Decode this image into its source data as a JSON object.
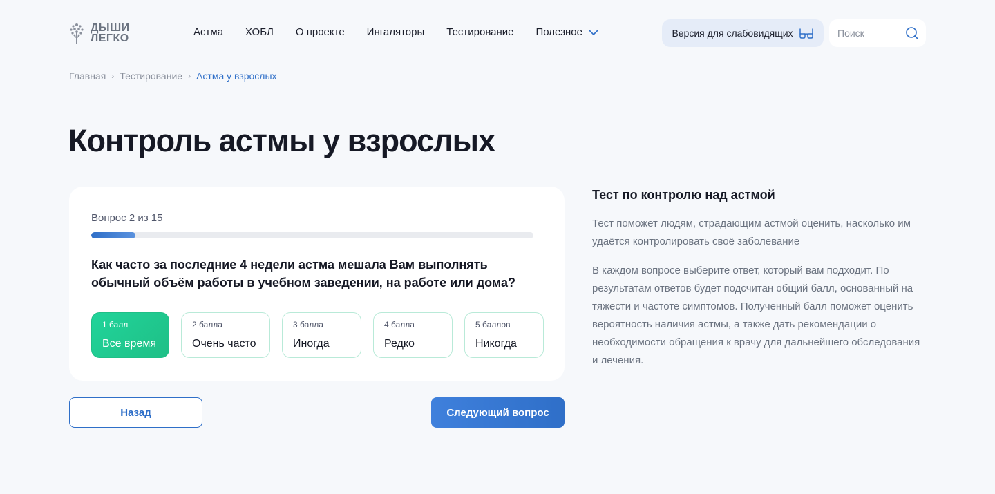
{
  "logo": {
    "line1": "ДЫШИ",
    "line2": "ЛЕГКО"
  },
  "nav": [
    {
      "label": "Астма"
    },
    {
      "label": "ХОБЛ"
    },
    {
      "label": "О проекте"
    },
    {
      "label": "Ингаляторы"
    },
    {
      "label": "Тестирование"
    },
    {
      "label": "Полезное"
    }
  ],
  "low_vision": {
    "label": "Версия для слабовидящих",
    "icon": "glasses-icon"
  },
  "search": {
    "placeholder": "Поиск",
    "icon": "search-icon"
  },
  "breadcrumb": [
    {
      "label": "Главная"
    },
    {
      "label": "Тестирование"
    },
    {
      "label": "Астма у взрослых"
    }
  ],
  "page_title": "Контроль астмы у взрослых",
  "quiz": {
    "counter": "Вопрос 2 из 15",
    "progress_fraction": 0.1,
    "question": "Как часто за последние 4 недели астма мешала Вам выполнять обычный объём работы в учебном заведении, на работе или дома?",
    "options": [
      {
        "score": "1 балл",
        "answer": "Все время",
        "selected": true
      },
      {
        "score": "2 балла",
        "answer": "Очень часто",
        "selected": false
      },
      {
        "score": "3 балла",
        "answer": "Иногда",
        "selected": false
      },
      {
        "score": "4 балла",
        "answer": "Редко",
        "selected": false
      },
      {
        "score": "5 баллов",
        "answer": "Никогда",
        "selected": false
      }
    ],
    "back_label": "Назад",
    "next_label": "Следующий вопрос"
  },
  "info": {
    "title": "Тест по контролю над астмой",
    "paragraph1": "Тест поможет людям, страдающим астмой оценить, насколько им удаётся контролировать своё заболевание",
    "paragraph2": "В каждом вопросе выберите ответ, который вам подходит. По результатам ответов будет подсчитан общий балл, основанный на тяжести и частоте симптомов. Полученный балл поможет оценить вероятность наличия астмы, а также дать рекомендации о необходимости обращения к врачу для дальнейшего обследования и лечения."
  },
  "colors": {
    "accent": "#2f6fc8",
    "selected_option": "#1fbf86",
    "option_border": "#b9ead8",
    "background": "#f6f8fb"
  }
}
